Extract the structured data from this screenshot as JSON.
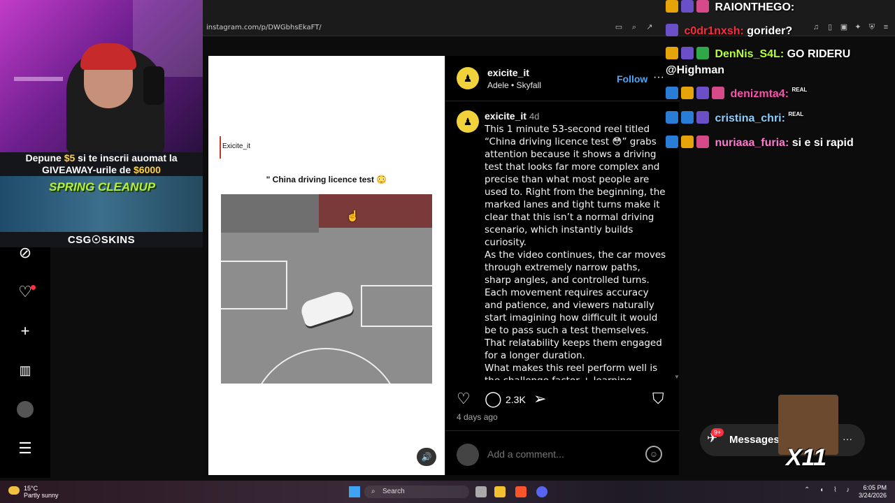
{
  "browser": {
    "url": "instagram.com/p/DWGbhsEkaFT/"
  },
  "stream": {
    "promo_line1_prefix": "Depune ",
    "promo_amount1": "$5",
    "promo_line1_suffix": " si te inscrii auomat la",
    "promo_line2_prefix": "GIVEAWAY-urile de ",
    "promo_amount2": "$6000",
    "promo_art_title": "SPRING CLEANUP",
    "sponsor": "CSG☉SKINS"
  },
  "post": {
    "video_handle": "Exicite_it",
    "video_title": "\" China driving licence test 😳",
    "author": "exicite_it",
    "music": "Adele • Skyfall",
    "follow_label": "Follow",
    "more_label": "···",
    "caption_user": "exicite_it",
    "caption_time": "4d",
    "caption_paragraphs": [
      "This 1 minute 53-second reel titled “China driving licence test 😳” grabs attention because it shows a driving test that looks far more complex and precise than what most people are used to. Right from the beginning, the marked lanes and tight turns make it clear that this isn’t a normal driving scenario, which instantly builds curiosity.",
      "As the video continues, the car moves through extremely narrow paths, sharp angles, and controlled turns. Each movement requires accuracy and patience, and viewers naturally start imagining how difficult it would be to pass such a test themselves. That relatability keeps them engaged for a longer duration.",
      "What makes this reel perform well is the challenge factor + learning element. People are not just watching for"
    ],
    "comment_count": "2.3K",
    "posted_ago": "4 days ago",
    "comment_placeholder": "Add a comment..."
  },
  "chat": {
    "lines": [
      {
        "user": "RAIONTHEGO:",
        "text": "",
        "color": "#ffffff"
      },
      {
        "user": "c0dr1nxsh:",
        "text": "gorider?",
        "color": "#ff2a3d"
      },
      {
        "user": "DenNis_S4L:",
        "text": "GO RIDERU",
        "color": "#b6ff3a"
      },
      {
        "user": "",
        "text": "@Highman",
        "color": "#ffffff"
      },
      {
        "user": "denizmta4:",
        "text": "",
        "color": "#ff4fb0"
      },
      {
        "user": "cristina_chri:",
        "text": "",
        "color": "#8ad0ff"
      },
      {
        "user": "nuriaaa_furia:",
        "text": "si e si rapid",
        "color": "#ff7ad1"
      }
    ],
    "emote_label": "REAL"
  },
  "messages": {
    "label": "Messages",
    "badge": "9+",
    "overlay_text": "X11"
  },
  "taskbar": {
    "temp": "15°C",
    "weather": "Partly sunny",
    "search": "Search",
    "time": "6:05 PM",
    "date": "3/24/2026"
  }
}
